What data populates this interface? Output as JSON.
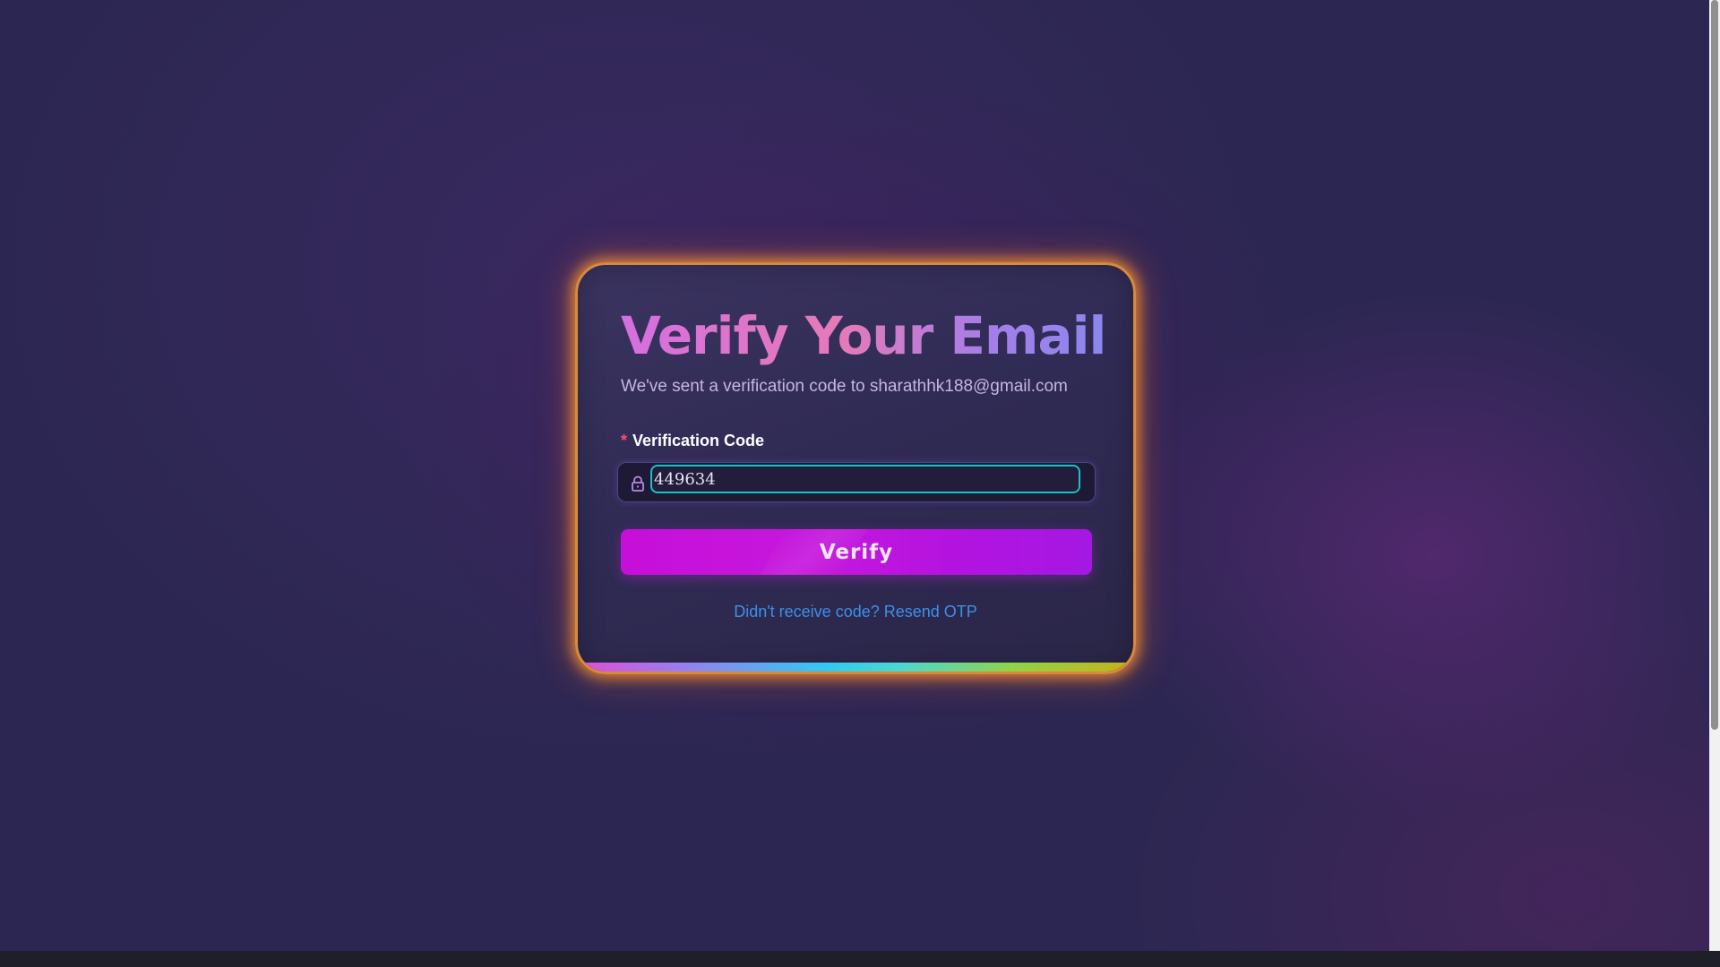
{
  "card": {
    "title": "Verify Your Email",
    "subtitle": "We've sent a verification code to sharathhk188@gmail.com"
  },
  "form": {
    "code_label": "Verification Code",
    "required_marker": "*",
    "code_value": "449634",
    "code_icon": "lock-icon"
  },
  "actions": {
    "verify_label": "Verify",
    "resend_text": "Didn't receive code? Resend OTP"
  },
  "colors": {
    "background": "#2c2752",
    "card_glow": "#d88a3c",
    "button": "#c60fd9",
    "link": "#3d8fe8",
    "input_focus": "#1ec0c8",
    "required": "#ff4d6d"
  }
}
